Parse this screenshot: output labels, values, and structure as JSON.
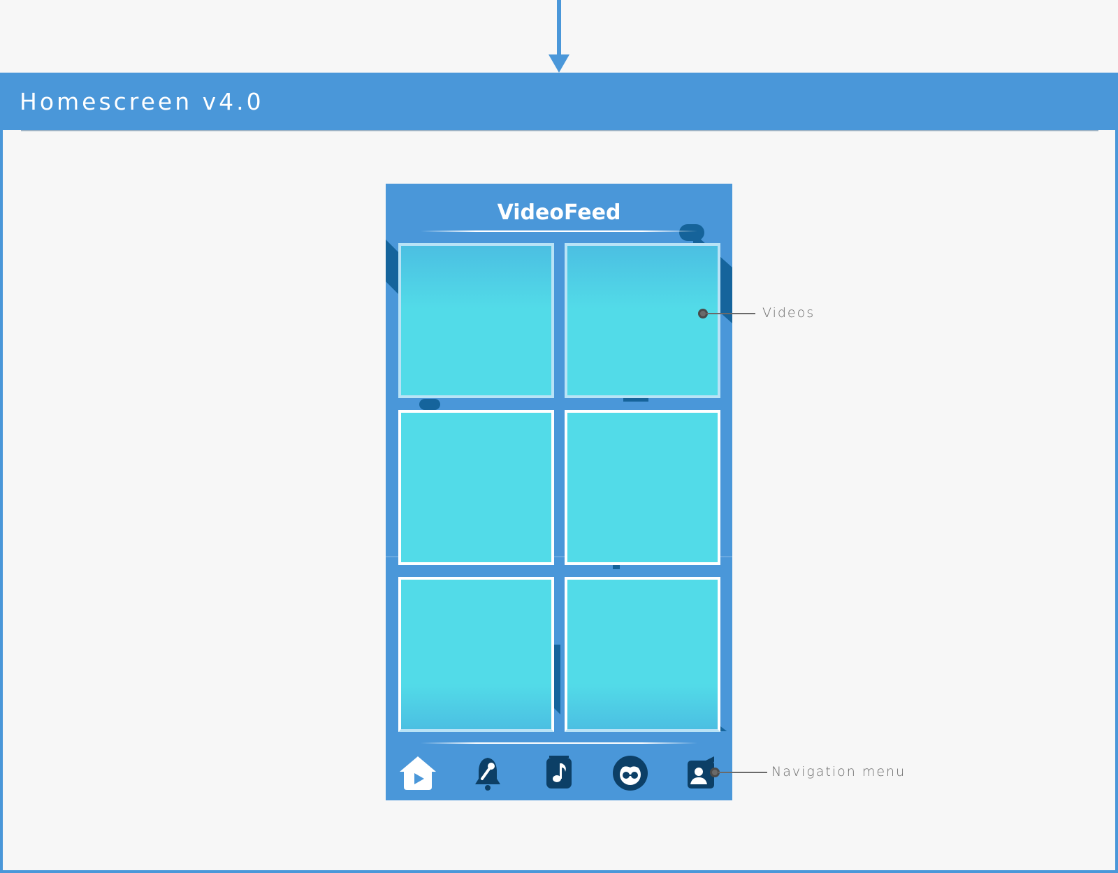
{
  "header": {
    "title": "Homescreen v4.0"
  },
  "phone": {
    "title": "VideoFeed",
    "tiles": [
      {
        "row": 0,
        "col": 0
      },
      {
        "row": 0,
        "col": 1
      },
      {
        "row": 1,
        "col": 0
      },
      {
        "row": 1,
        "col": 1
      },
      {
        "row": 2,
        "col": 0
      },
      {
        "row": 2,
        "col": 1
      }
    ],
    "nav_items": [
      {
        "name": "home-video-icon",
        "active": true
      },
      {
        "name": "microphone-bell-icon",
        "active": false
      },
      {
        "name": "music-note-icon",
        "active": false
      },
      {
        "name": "avatar-glasses-icon",
        "active": false
      },
      {
        "name": "profile-card-icon",
        "active": false
      }
    ]
  },
  "annotations": {
    "videos": "Videos",
    "navigation": "Navigation menu"
  },
  "colors": {
    "accent": "#4a97d9",
    "tile": "#52dbe8",
    "icon_dark": "#0c3f66",
    "background": "#f7f7f7",
    "callout": "#6a6a6a"
  }
}
